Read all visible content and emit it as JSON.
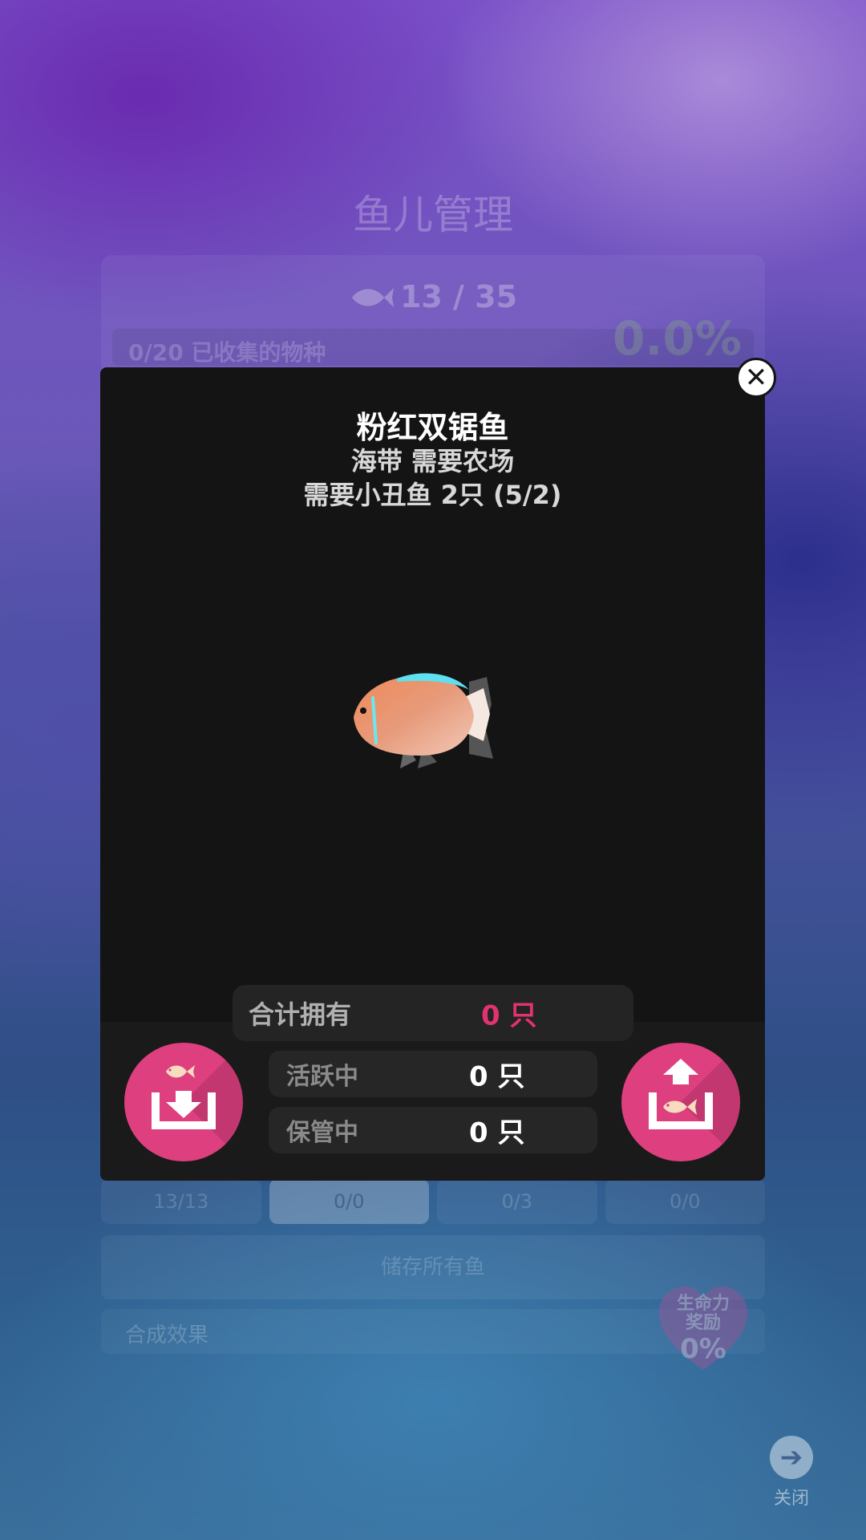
{
  "background": {
    "title": "鱼儿管理",
    "fish_count": "13 / 35",
    "collected": "0/20 已收集的物种",
    "percent": "0.0%",
    "tabs": [
      "13/13",
      "0/0",
      "0/3",
      "0/0"
    ],
    "store_all": "储存所有鱼",
    "synthesis": "合成效果",
    "vitality": {
      "line1": "生命力",
      "line2": "奖励",
      "value": "0%"
    },
    "close_label": "关闭"
  },
  "modal": {
    "name": "粉红双锯鱼",
    "line1": "海带 需要农场",
    "line2": "需要小丑鱼 2只 (5/2)",
    "total_label": "合计拥有",
    "total_value": "0 只",
    "active_label": "活跃中",
    "active_value": "0 只",
    "stored_label": "保管中",
    "stored_value": "0 只"
  },
  "colors": {
    "accent": "#dd3f7f",
    "total_value": "#e0336f",
    "modal_bg": "#141414"
  },
  "icons": {
    "close": "close-icon",
    "store": "store-fish-icon",
    "release": "release-fish-icon",
    "nav_close": "arrow-right-icon"
  }
}
